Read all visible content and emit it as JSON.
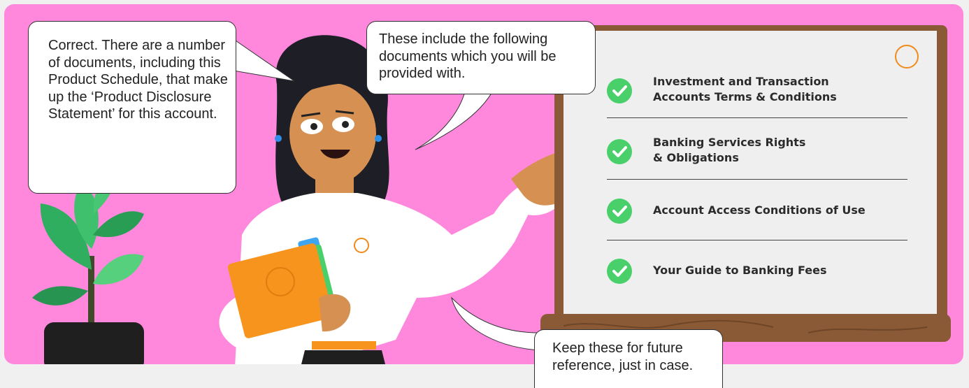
{
  "bubbles": {
    "intro": "Correct. There are a number of documents, including this Product Schedule, that make up the ‘Product Disclosure Statement’ for this account.",
    "documents_intro": "These include the following documents which you will be provided with.",
    "reminder": "Keep these for future reference, just in case."
  },
  "documents": [
    {
      "label": "Investment and Transaction\nAccounts Terms & Conditions",
      "icon": "check-icon"
    },
    {
      "label": "Banking Services Rights\n& Obligations",
      "icon": "check-icon"
    },
    {
      "label": "Account Access Conditions of Use",
      "icon": "check-icon"
    },
    {
      "label": "Your Guide to Banking Fees",
      "icon": "check-icon"
    }
  ],
  "colors": {
    "background": "#ff88dd",
    "board_frame": "#8a5a36",
    "board_surface": "#efefef",
    "check": "#49d06a",
    "brand": "#f08a1a",
    "folder": "#f7941d"
  }
}
